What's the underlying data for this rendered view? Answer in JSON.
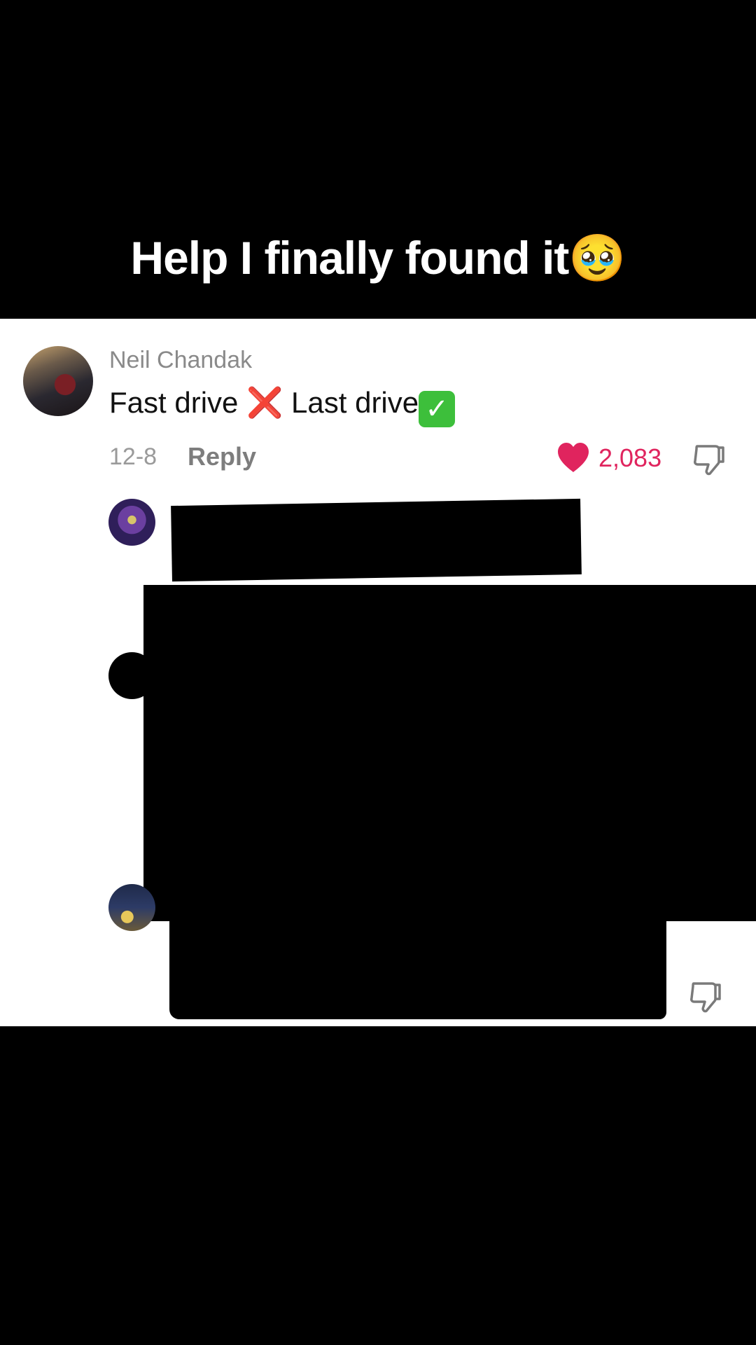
{
  "video": {
    "caption": "Help I finally found it",
    "caption_emoji": "🥹"
  },
  "comment": {
    "username": "Neil Chandak",
    "text_part1": "Fast drive ",
    "cross_emoji": "❌",
    "text_part2": " Last drive",
    "check_emoji": "✅",
    "date": "12-8",
    "reply_label": "Reply",
    "like_count": "2,083",
    "accent_color": "#e0245e"
  },
  "icons": {
    "like": "heart-icon",
    "dislike": "thumbs-down-icon"
  }
}
